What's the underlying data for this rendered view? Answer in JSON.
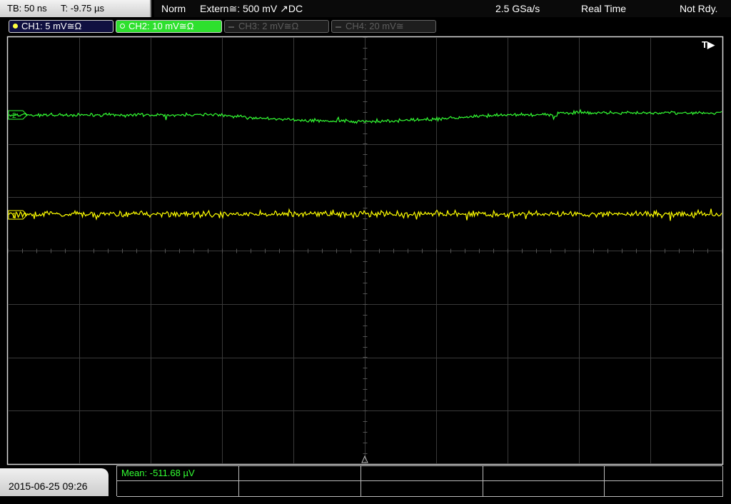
{
  "timebase": {
    "tb": "TB: 50 ns",
    "t": "T: -9.75 µs"
  },
  "status": {
    "mode": "Norm",
    "trigger": "Extern≅: 500 mV ↗DC",
    "sample_rate": "2.5 GSa/s",
    "acq": "Real Time",
    "state": "Not Rdy."
  },
  "channels": [
    {
      "label": "CH1: 5 mV≅Ω",
      "color": "#ffff40",
      "active": true
    },
    {
      "label": "CH2: 10 mV≅Ω",
      "color": "#2ee02e",
      "active": true
    },
    {
      "label": "CH3: 2 mV≅Ω",
      "color": "#5e5e5e",
      "active": false
    },
    {
      "label": "CH4: 20 mV≅",
      "color": "#5e5e5e",
      "active": false
    }
  ],
  "markers": {
    "ch1": "1",
    "ch2": "2",
    "trigger_pos": "T▶"
  },
  "datetime": "2015-06-25 09:26",
  "measurement": {
    "label": "Mean: -511.68 µV"
  },
  "colors": {
    "grid": "#3a3a3a",
    "ch1_trace": "#ffff00",
    "ch2_trace": "#33ff33",
    "border": "#d8d8d8"
  }
}
